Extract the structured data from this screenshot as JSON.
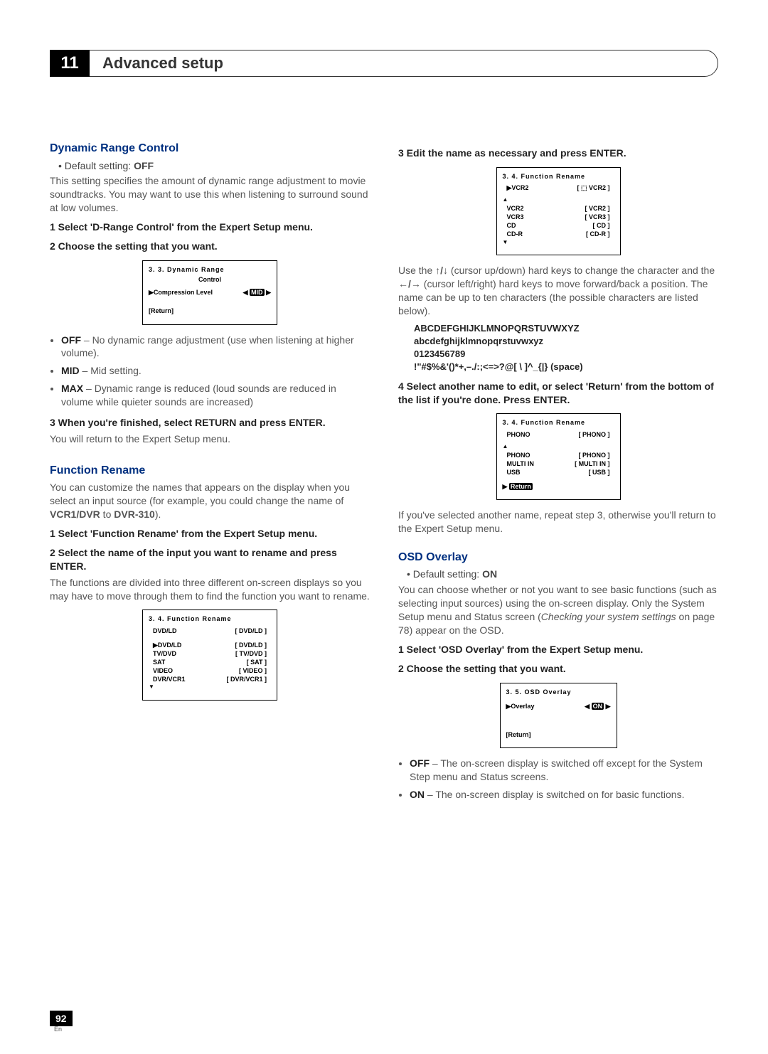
{
  "chapter": {
    "number": "11",
    "title": "Advanced setup"
  },
  "left": {
    "drc": {
      "title": "Dynamic Range Control",
      "default": "Default setting: ",
      "default_val": "OFF",
      "intro": "This setting specifies the amount of dynamic range adjustment to movie soundtracks. You may want to use this when listening to surround sound at low volumes.",
      "step1": "1   Select 'D-Range Control' from the Expert Setup menu.",
      "step2": "2   Choose the setting that you want.",
      "osd": {
        "title": "3. 3. Dynamic  Range",
        "title2": "Control",
        "row1_left": "▶Compression Level",
        "row1_right_l": "◀",
        "row1_right_mid": "MID",
        "row1_right_r": "▶",
        "return": "[Return]"
      },
      "opt_off_b": "OFF",
      "opt_off": " – No dynamic range adjustment (use when listening at higher volume).",
      "opt_mid_b": "MID",
      "opt_mid": " – Mid setting.",
      "opt_max_b": "MAX",
      "opt_max": " – Dynamic range is reduced (loud sounds are reduced in volume while quieter sounds are increased)",
      "step3": "3   When you're finished, select RETURN and press ENTER.",
      "step3_after": "You will return to the Expert Setup menu."
    },
    "fr": {
      "title": "Function Rename",
      "intro1": "You can customize the names that appears on the display when you select an input source (for example, you could change the name of ",
      "intro_b1": "VCR1/DVR",
      "intro_mid": " to ",
      "intro_b2": "DVR-310",
      "intro_end": ").",
      "step1": "1   Select 'Function Rename' from the Expert Setup menu.",
      "step2": "2   Select the name of the input you want to rename and press ENTER.",
      "step2_after": "The functions are divided into three different on-screen displays so you may have to move through them to find the function you want to rename.",
      "osd": {
        "title": "3. 4. Function  Rename",
        "top_left": "DVD/LD",
        "top_right": "DVD/LD",
        "rows": [
          {
            "l": "▶DVD/LD",
            "r": "DVD/LD"
          },
          {
            "l": "  TV/DVD",
            "r": "TV/DVD"
          },
          {
            "l": "  SAT",
            "r": "SAT"
          },
          {
            "l": "  VIDEO",
            "r": "VIDEO"
          },
          {
            "l": "  DVR/VCR1",
            "r": "DVR/VCR1"
          }
        ]
      }
    }
  },
  "right": {
    "step3": "3   Edit the name as necessary and press ENTER.",
    "osd1": {
      "title": "3. 4. Function  Rename",
      "top_l": "▶VCR2",
      "top_r": "VCR2",
      "rows": [
        {
          "l": "VCR2",
          "r": "VCR2"
        },
        {
          "l": "VCR3",
          "r": "VCR3"
        },
        {
          "l": "CD",
          "r": "CD"
        },
        {
          "l": "CD-R",
          "r": "CD-R"
        }
      ]
    },
    "cursor_p_1": "Use the ",
    "cursor_p_2": " (cursor up/down) hard keys to change the character and the ",
    "cursor_p_3": " (cursor left/right) hard keys to move forward/back a position. The name can be up to ten characters (the possible characters are listed below).",
    "chars1": "ABCDEFGHIJKLMNOPQRSTUVWXYZ",
    "chars2": "abcdefghijklmnopqrstuvwxyz",
    "chars3": "0123456789",
    "chars4": "!\"#$%&'()*+,–./:;<=>?@[ \\ ]^_{|} (space)",
    "step4": "4   Select another name to edit, or select 'Return' from the bottom of the list if you're done. Press ENTER.",
    "osd2": {
      "title": "3. 4. Function  Rename",
      "top_l": "PHONO",
      "top_r": "PHONO",
      "rows": [
        {
          "l": "PHONO",
          "r": "PHONO"
        },
        {
          "l": "MULTI   IN",
          "r": "MULTI   IN"
        },
        {
          "l": "USB",
          "r": "USB"
        }
      ],
      "return": "Return"
    },
    "after_step4": "If you've selected another name, repeat step 3, otherwise you'll return to the Expert Setup menu.",
    "osd_ov": {
      "title": "OSD Overlay",
      "default": "Default setting: ",
      "default_val": "ON",
      "intro1": "You can choose whether or not you want to see basic functions (such as selecting input sources) using the on-screen display. Only the System Setup menu and Status screen (",
      "intro_i": "Checking your system settings",
      "intro2": " on page 78) appear on the OSD.",
      "step1": "1   Select 'OSD Overlay' from the Expert Setup menu.",
      "step2": "2   Choose the setting that you want.",
      "box": {
        "title": "3. 5. OSD Overlay",
        "row_l": "▶Overlay",
        "row_r_l": "◀",
        "row_r_mid": "ON",
        "row_r_r": "▶",
        "return": "[Return]"
      },
      "opt_off_b": "OFF",
      "opt_off": " – The on-screen display is switched off except for the System Step menu and Status screens.",
      "opt_on_b": "ON",
      "opt_on": " – The on-screen display is switched on for basic functions."
    }
  },
  "footer": {
    "page": "92",
    "lang": "En"
  }
}
